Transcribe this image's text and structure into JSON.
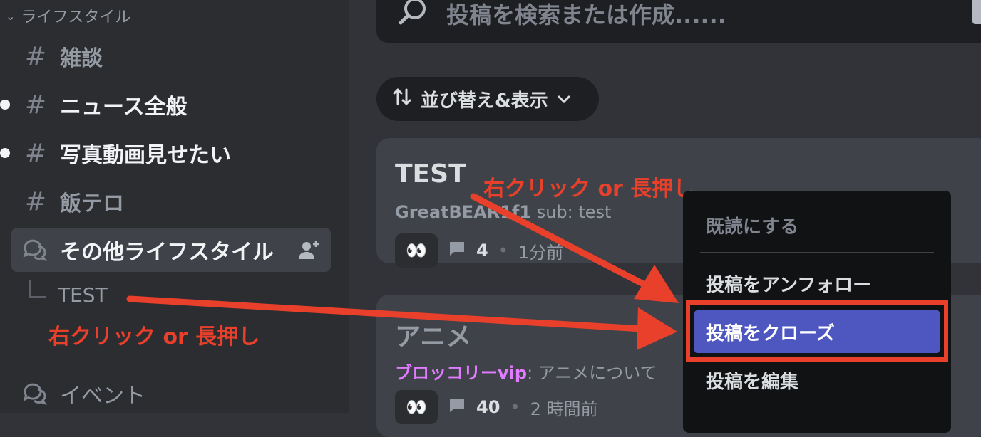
{
  "sidebar": {
    "category": "ライフスタイル",
    "channels": [
      {
        "name": "雑談"
      },
      {
        "name": "ニュース全般"
      },
      {
        "name": "写真動画見せたい"
      },
      {
        "name": "飯テロ"
      },
      {
        "name": "その他ライフスタイル"
      }
    ],
    "thread": "TEST",
    "event_channel": "イベント"
  },
  "annotations": {
    "left": "右クリック or 長押し",
    "right": "右クリック or 長押し",
    "color": "#e8402b"
  },
  "main": {
    "search_placeholder": "投稿を検索または作成......",
    "sort_label": "並び替え&表示",
    "posts": [
      {
        "title": "TEST",
        "author": "GreatBEAR1f1",
        "text": " sub: test",
        "emoji": "👀",
        "count": "4",
        "time": "1分前"
      },
      {
        "title": "アニメ",
        "author": "ブロッコリーvip",
        "text": ": アニメについて",
        "emoji": "👀",
        "count": "40",
        "time": "2 時間前"
      }
    ]
  },
  "context_menu": {
    "items": [
      "既読にする",
      "投稿をアンフォロー",
      "投稿をクローズ",
      "投稿を編集"
    ]
  },
  "colors": {
    "accent": "#4e56c0",
    "author_pink": "#e17bff"
  }
}
